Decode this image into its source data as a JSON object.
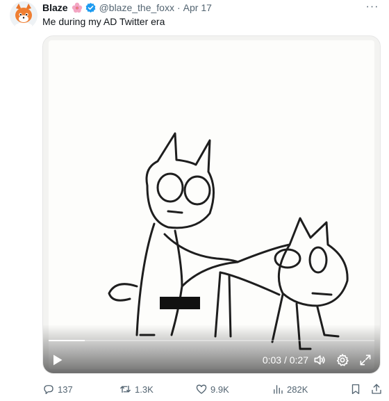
{
  "tweet": {
    "author_name": "Blaze",
    "author_handle": "@blaze_the_foxx",
    "separator": "·",
    "date": "Apr 17",
    "text": "Me during my AD Twitter era",
    "more_label": "···"
  },
  "video": {
    "current_time": "0:03",
    "time_separator": " / ",
    "duration": "0:27",
    "progress_fraction": 0.11
  },
  "actions": {
    "replies": "137",
    "reposts": "1.3K",
    "likes": "9.9K",
    "views": "282K"
  },
  "colors": {
    "accent_blue": "#1d9bf0",
    "muted_text": "#536471",
    "main_text": "#0f1419"
  },
  "icons": {
    "verified": "verified-badge-icon",
    "flower": "hibiscus-emoji-icon",
    "more": "more-options-icon",
    "play": "play-icon",
    "volume": "volume-icon",
    "settings": "gear-icon",
    "fullscreen": "fullscreen-icon",
    "reply": "reply-icon",
    "repost": "repost-icon",
    "like": "heart-icon",
    "views": "views-chart-icon",
    "bookmark": "bookmark-icon",
    "share": "share-icon"
  }
}
